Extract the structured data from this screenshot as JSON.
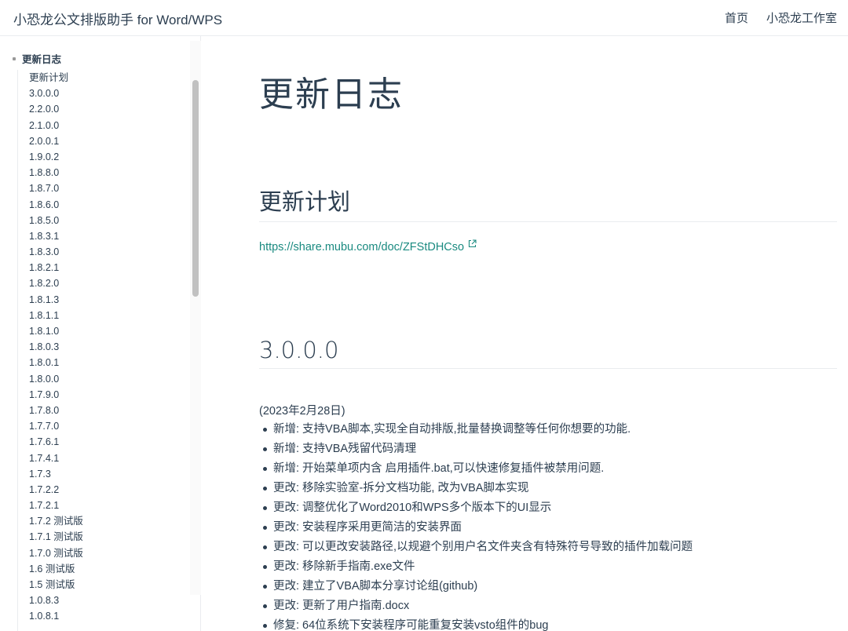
{
  "navbar": {
    "site_name": "小恐龙公文排版助手 for Word/WPS",
    "links": [
      "首页",
      "小恐龙工作室"
    ]
  },
  "sidebar": {
    "group_title": "更新日志",
    "items": [
      "更新计划",
      "3.0.0.0",
      "2.2.0.0",
      "2.1.0.0",
      "2.0.0.1",
      "1.9.0.2",
      "1.8.8.0",
      "1.8.7.0",
      "1.8.6.0",
      "1.8.5.0",
      "1.8.3.1",
      "1.8.3.0",
      "1.8.2.1",
      "1.8.2.0",
      "1.8.1.3",
      "1.8.1.1",
      "1.8.1.0",
      "1.8.0.3",
      "1.8.0.1",
      "1.8.0.0",
      "1.7.9.0",
      "1.7.8.0",
      "1.7.7.0",
      "1.7.6.1",
      "1.7.4.1",
      "1.7.3",
      "1.7.2.2",
      "1.7.2.1",
      "1.7.2 测试版",
      "1.7.1 测试版",
      "1.7.0 测试版",
      "1.6 测试版",
      "1.5 测试版",
      "1.0.8.3",
      "1.0.8.1"
    ]
  },
  "content": {
    "title": "更新日志",
    "plan_heading": "更新计划",
    "plan_link": "https://share.mubu.com/doc/ZFStDHCso",
    "version_heading": "3.0.0.0",
    "version_date": "(2023年2月28日)",
    "changes": [
      "新增: 支持VBA脚本,实现全自动排版,批量替换调整等任何你想要的功能.",
      "新增: 支持VBA残留代码清理",
      "新增: 开始菜单项内含 启用插件.bat,可以快速修复插件被禁用问题.",
      "更改: 移除实验室-拆分文档功能, 改为VBA脚本实现",
      "更改: 调整优化了Word2010和WPS多个版本下的UI显示",
      "更改: 安装程序采用更简洁的安装界面",
      "更改: 可以更改安装路径,以规避个别用户名文件夹含有特殊符号导致的插件加载问题",
      "更改: 移除新手指南.exe文件",
      "更改: 建立了VBA脚本分享讨论组(github)",
      "更改: 更新了用户指南.docx",
      "修复: 64位系统下安装程序可能重复安装vsto组件的bug"
    ]
  },
  "colors": {
    "text": "#2c3e50",
    "link": "#1a8a80",
    "border": "#eaecef"
  },
  "icons": {
    "external_link": "external-link-icon"
  }
}
